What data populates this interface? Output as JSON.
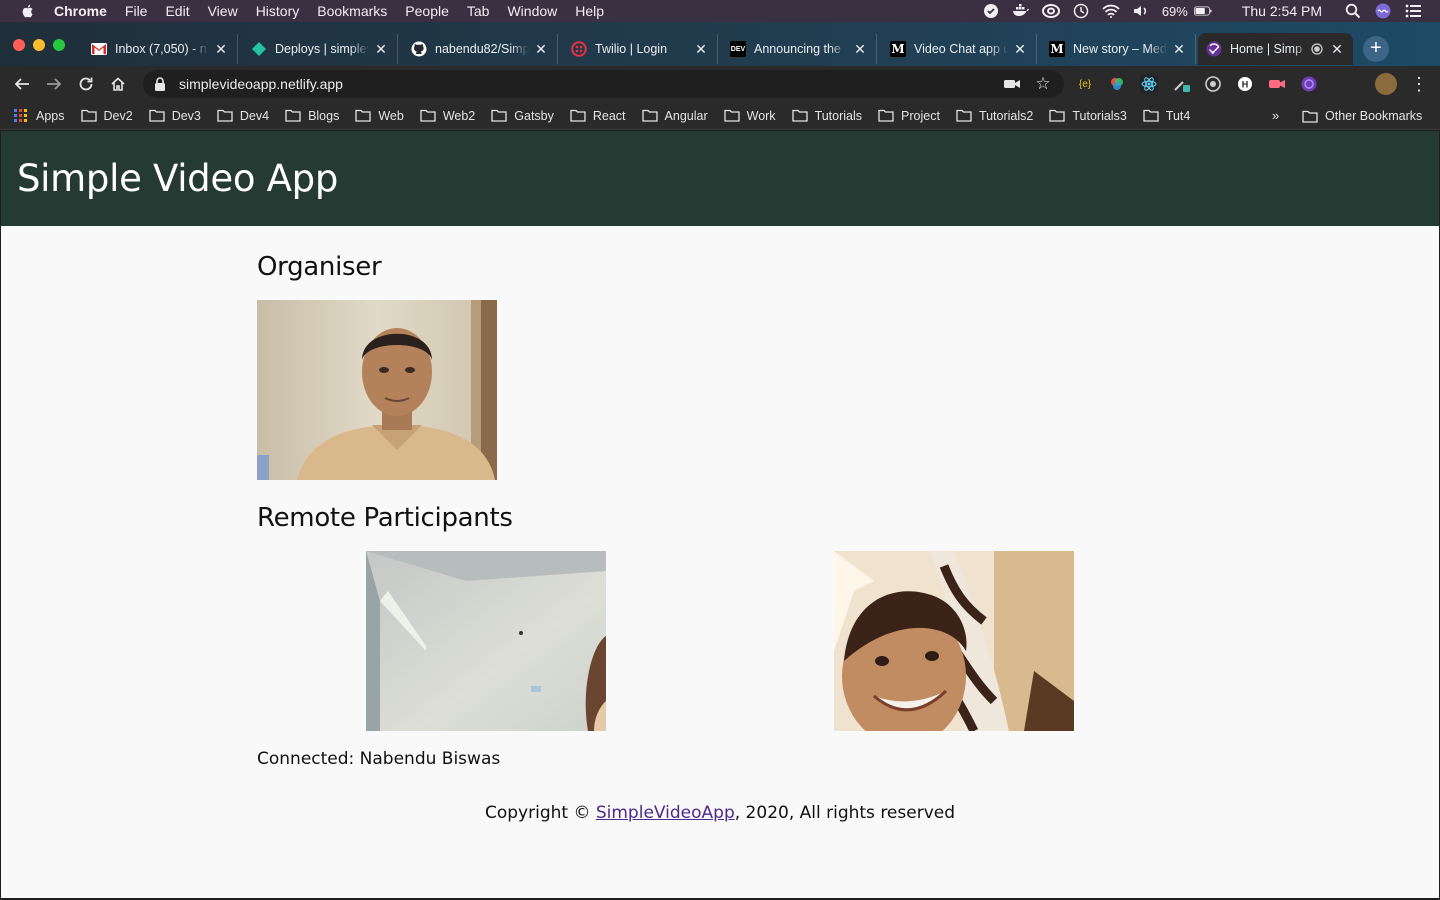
{
  "menubar": {
    "app_name": "Chrome",
    "items": [
      "File",
      "Edit",
      "View",
      "History",
      "Bookmarks",
      "People",
      "Tab",
      "Window",
      "Help"
    ],
    "battery": "69%",
    "clock": "Thu 2:54 PM"
  },
  "tabs": [
    {
      "label": "Inbox (7,050) - n",
      "favicon": "gmail-icon",
      "color": "#d93025"
    },
    {
      "label": "Deploys | simplev",
      "favicon": "netlify-icon",
      "color": "#25c2a0"
    },
    {
      "label": "nabendu82/Simp",
      "favicon": "github-icon",
      "color": "#ffffff"
    },
    {
      "label": "Twilio | Login",
      "favicon": "twilio-icon",
      "color": "#e8313e"
    },
    {
      "label": "Announcing the",
      "favicon": "dev-icon",
      "color": "#000000"
    },
    {
      "label": "Video Chat app u",
      "favicon": "medium-icon",
      "color": "#000000"
    },
    {
      "label": "New story – Med",
      "favicon": "medium-icon",
      "color": "#000000"
    },
    {
      "label": "Home | Simp",
      "favicon": "gatsby-icon",
      "color": "#663399"
    }
  ],
  "address_bar": {
    "url": "simplevideoapp.netlify.app"
  },
  "bookmarks": {
    "apps_label": "Apps",
    "folders": [
      "Dev2",
      "Dev3",
      "Dev4",
      "Blogs",
      "Web",
      "Web2",
      "Gatsby",
      "React",
      "Angular",
      "Work",
      "Tutorials",
      "Project",
      "Tutorials2",
      "Tutorials3",
      "Tut4"
    ],
    "overflow": "»",
    "other_label": "Other Bookmarks"
  },
  "page": {
    "site_title": "Simple Video App",
    "organiser_heading": "Organiser",
    "remote_heading": "Remote Participants",
    "connected_text": "Connected: Nabendu Biswas",
    "footer": {
      "prefix": "Copyright © ",
      "link_text": "SimpleVideoApp",
      "suffix": ", 2020, All rights reserved"
    }
  },
  "colors": {
    "header_bg": "#253a33",
    "page_bg": "#f9f9f9",
    "link": "#4b2a8c"
  }
}
